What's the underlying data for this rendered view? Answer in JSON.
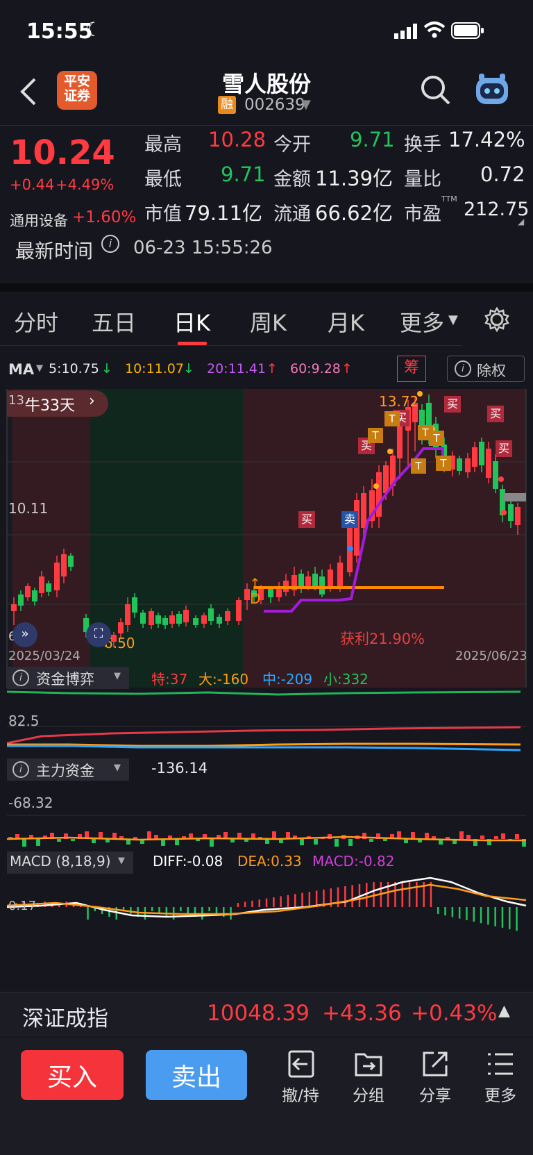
{
  "status": {
    "time": "15:55"
  },
  "header": {
    "broker_logo": "平安\n证券",
    "stock_name": "雪人股份",
    "margin_badge": "融",
    "stock_code": "002639"
  },
  "quote": {
    "price": "10.24",
    "change": "+0.44",
    "change_pct": "+4.49%",
    "sector_name": "通用设备",
    "sector_pct": "+1.60%",
    "high_label": "最高",
    "high": "10.28",
    "low_label": "最低",
    "low": "9.71",
    "mcap_label": "市值",
    "mcap": "79.11亿",
    "open_label": "今开",
    "open": "9.71",
    "amount_label": "金额",
    "amount": "11.39亿",
    "float_label": "流通",
    "float": "66.62亿",
    "turnover_label": "换手",
    "turnover": "17.42%",
    "vol_ratio_label": "量比",
    "vol_ratio": "0.72",
    "pe_label": "市盈",
    "pe_sup": "TTM",
    "pe": "212.75",
    "time_label": "最新时间",
    "time_value": "06-23 15:55:26"
  },
  "tabs": [
    "分时",
    "五日",
    "日K",
    "周K",
    "月K",
    "更多"
  ],
  "active_tab": 2,
  "ma": {
    "label": "MA",
    "ma5": "5:10.75",
    "ma10": "10:11.07",
    "ma20": "20:11.41",
    "ma60": "60:9.28",
    "chip_btn": "筹",
    "exright_btn": "除权"
  },
  "kline": {
    "bull_badge": "牛33天",
    "top_label": "13.",
    "high_mark": "13.72",
    "mid_label": "10.11",
    "low_mark": "6.50",
    "bottom_label": "6.",
    "profit": "获利21.90%",
    "start_date": "2025/03/24",
    "end_date": "2025/06/23",
    "buy": "买",
    "sell": "卖",
    "t": "T",
    "d": "D"
  },
  "fund_game": {
    "title": "资金博弈",
    "te": "特:37",
    "da": "大:-160",
    "zhong": "中:-209",
    "xiao": "小:332",
    "axis": "82.5"
  },
  "main_fund": {
    "title": "主力资金",
    "value": "-136.14",
    "axis": "-68.32"
  },
  "macd": {
    "title": "MACD (8,18,9)",
    "diff": "DIFF:-0.08",
    "dea": "DEA:0.33",
    "macd": "MACD:-0.82",
    "axis": "0.17"
  },
  "index_bar": {
    "name": "深证成指",
    "value": "10048.39",
    "change": "+43.36",
    "pct": "+0.43%"
  },
  "actions": {
    "buy": "买入",
    "sell": "卖出",
    "cancel": "撤/持",
    "group": "分组",
    "share": "分享",
    "more": "更多"
  },
  "colors": {
    "up": "#ff3b41",
    "down": "#21c45a",
    "buy_button": "#f5333b",
    "sell_button": "#4a9cf0"
  }
}
